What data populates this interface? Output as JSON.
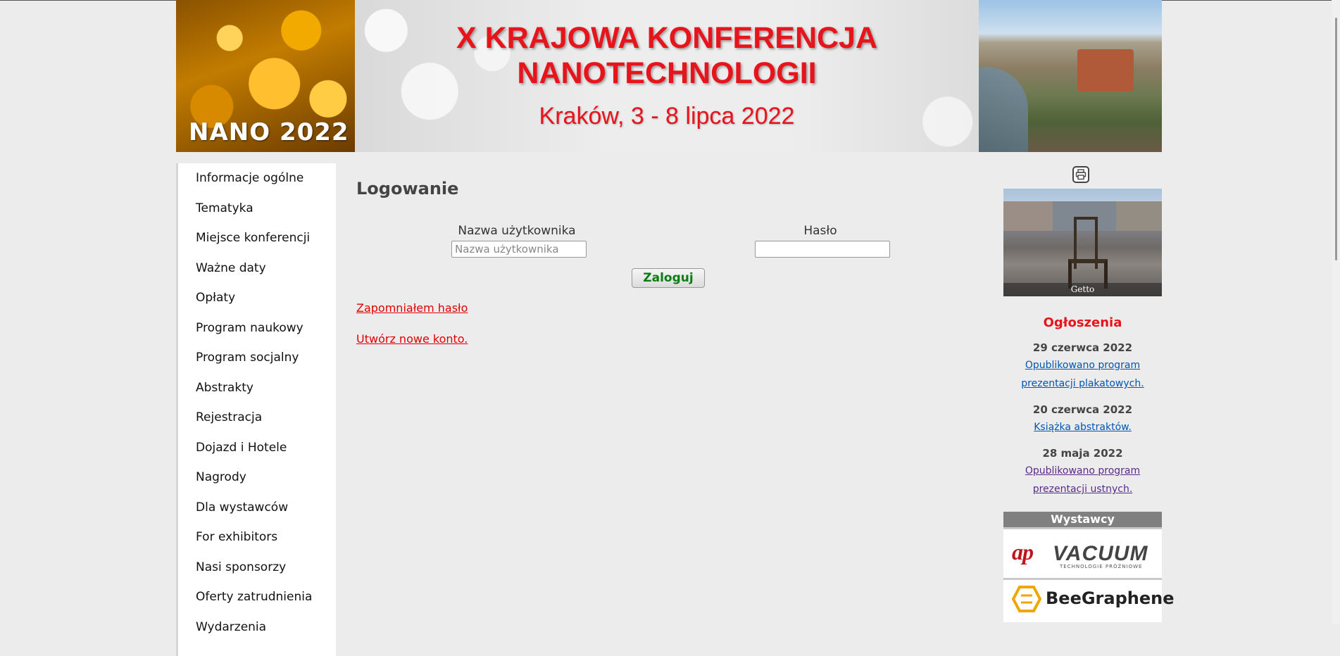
{
  "banner": {
    "left_text": "NANO 2022",
    "title_line1": "X KRAJOWA KONFERENCJA",
    "title_line2": "NANOTECHNOLOGII",
    "subtitle": "Kraków, 3 - 8 lipca 2022"
  },
  "sidebar": {
    "items": [
      {
        "label": "Informacje ogólne"
      },
      {
        "label": "Tematyka"
      },
      {
        "label": "Miejsce konferencji"
      },
      {
        "label": "Ważne daty"
      },
      {
        "label": "Opłaty"
      },
      {
        "label": "Program naukowy"
      },
      {
        "label": "Program socjalny"
      },
      {
        "label": "Abstrakty"
      },
      {
        "label": "Rejestracja"
      },
      {
        "label": "Dojazd i Hotele"
      },
      {
        "label": "Nagrody"
      },
      {
        "label": "Dla wystawców"
      },
      {
        "label": "For exhibitors"
      },
      {
        "label": "Nasi sponsorzy"
      },
      {
        "label": "Oferty zatrudnienia"
      },
      {
        "label": "Wydarzenia"
      }
    ]
  },
  "login": {
    "title": "Logowanie",
    "username_label": "Nazwa użytkownika",
    "username_placeholder": "Nazwa użytkownika",
    "username_value": "",
    "password_label": "Hasło",
    "password_value": "",
    "submit_label": "Zaloguj",
    "forgot_link": "Zapomniałem hasło",
    "create_account_link": "Utwórz nowe konto."
  },
  "right": {
    "print_icon": "printer-icon",
    "photo_caption": "Getto",
    "announcements_title": "Ogłoszenia",
    "announcements": [
      {
        "date": "29 czerwca 2022",
        "line1": "Opublikowano program",
        "line2": "prezentacji plakatowych."
      },
      {
        "date": "20 czerwca 2022",
        "line1": "Książka abstraktów.",
        "line2": ""
      },
      {
        "date": "28 maja 2022",
        "line1": "Opublikowano program",
        "line2": "prezentacji ustnych."
      }
    ],
    "exhibitors_title": "Wystawcy",
    "exhibitors": [
      {
        "logo_left": "ap",
        "logo_right": "VACUUM",
        "tagline": "TECHNOLOGIE PRÓŻNIOWE"
      },
      {
        "logo_text": "BeeGraphene"
      }
    ]
  },
  "colors": {
    "accent_red": "#e8141c",
    "link_blue": "#0056b3",
    "button_text_green": "#0a7d14",
    "background": "#ececec"
  }
}
